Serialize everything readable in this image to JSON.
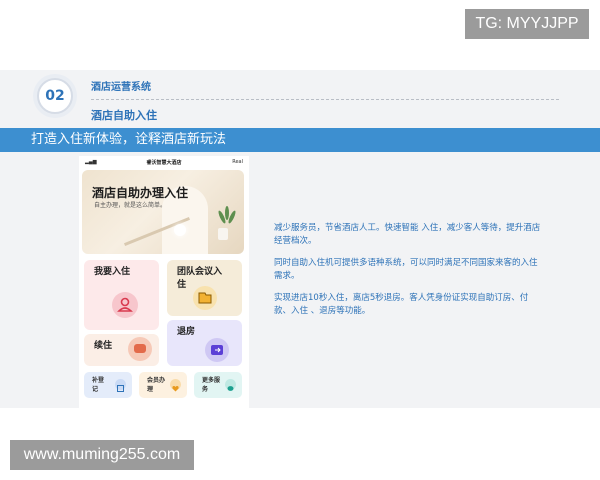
{
  "watermarks": {
    "tg": "TG: MYYJJPP",
    "site": "www.muming255.com"
  },
  "section": {
    "number": "02",
    "title": "酒店运营系统",
    "subtitle": "酒店自助入住"
  },
  "banner": {
    "text": "打造入住新体验，诠释酒店新玩法"
  },
  "phone": {
    "status_left": "▂▄▆",
    "app_title": "睿沃智慧大酒店",
    "status_right": "Real",
    "hero_title": "酒店自助办理入住",
    "hero_subtitle": "自主办理，就是这么简单。",
    "tiles": [
      {
        "label": "我要入住",
        "icon": "user-icon"
      },
      {
        "label": "团队会议入住",
        "icon": "folder-icon"
      },
      {
        "label": "续住",
        "icon": "chat-icon"
      },
      {
        "label": "退房",
        "icon": "card-icon"
      }
    ],
    "small_tiles": [
      {
        "label": "补登记",
        "icon": "scan-icon"
      },
      {
        "label": "会员办理",
        "icon": "heart-icon"
      },
      {
        "label": "更多服务",
        "icon": "message-icon"
      }
    ]
  },
  "description": [
    "减少服务员，节省酒店人工。快速智能 入住，减少客人等待，提升酒店经营档次。",
    "同时自助入住机可提供多语种系统，可以同时满足不同国家来客的入住需求。",
    "实现进店10秒入住，离店5秒退房。客人凭身份证实现自助订房、付款、入住 、退房等功能。"
  ],
  "colors": {
    "accent": "#2e73b8",
    "banner": "#3d8fd0"
  }
}
